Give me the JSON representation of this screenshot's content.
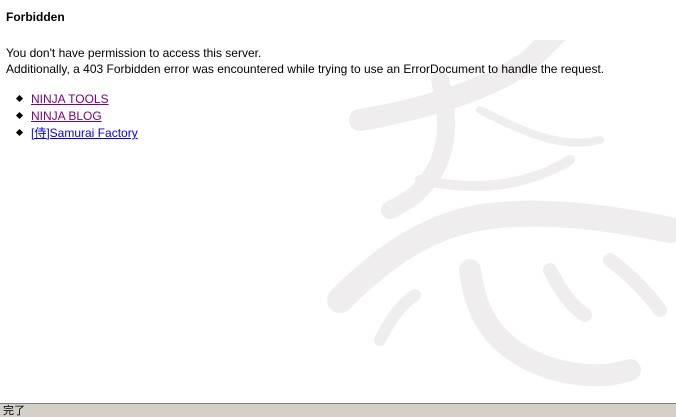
{
  "page": {
    "title": "Forbidden",
    "message_line1": "You don't have permission to access this server.",
    "message_line2": "Additionally, a 403 Forbidden error was encountered while trying to use an ErrorDocument to handle the request."
  },
  "links": [
    {
      "label": "NINJA TOOLS",
      "visited": true
    },
    {
      "label": "NINJA BLOG",
      "visited": true
    },
    {
      "label": "[侍]Samurai Factory",
      "visited": false
    }
  ],
  "status_bar": {
    "text": "完了"
  },
  "colors": {
    "visited_link": "#800080",
    "unvisited_link": "#0000ee",
    "watermark": "#f0eeee"
  },
  "watermark": {
    "icon": "ninja-kanji-watermark"
  }
}
